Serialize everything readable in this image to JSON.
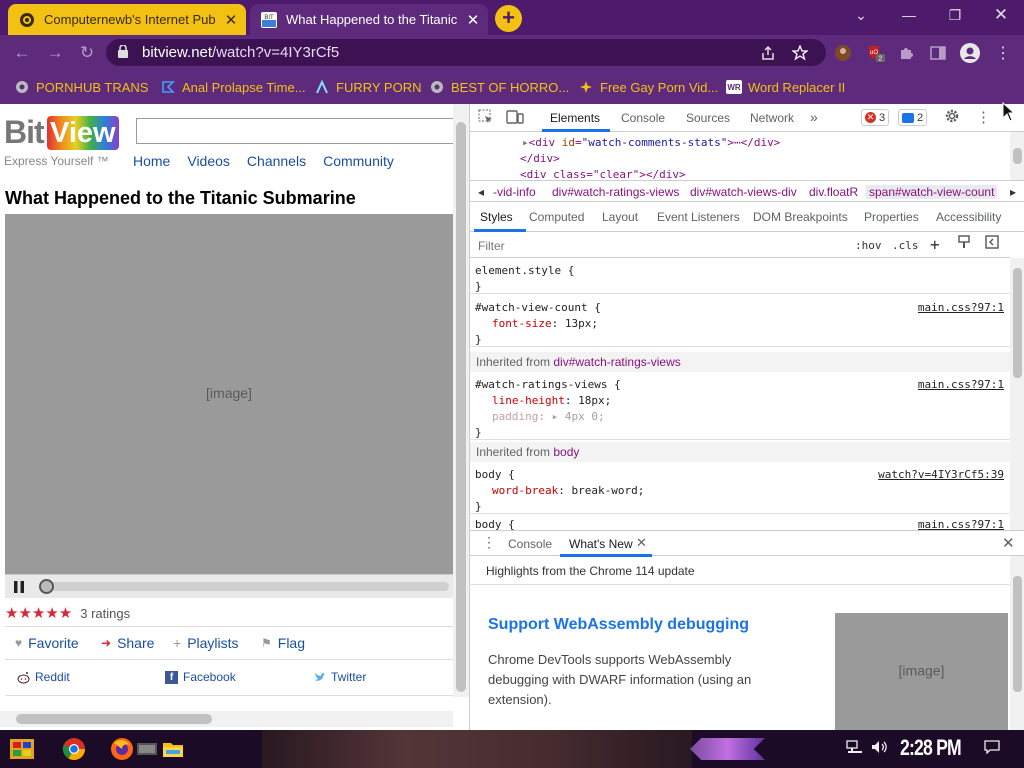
{
  "browser": {
    "tabs": [
      {
        "title": "Computernewb's Internet Pub",
        "close": "✕"
      },
      {
        "title": "What Happened to the Titanic",
        "close": "✕"
      }
    ],
    "new_tab_label": "+",
    "url_host": "bitview.net",
    "url_path": "/watch?v=4IY3rCf5",
    "bookmarks": [
      {
        "label": "PORNHUB TRANS"
      },
      {
        "label": "Anal Prolapse Time..."
      },
      {
        "label": "FURRY PORN"
      },
      {
        "label": "BEST OF HORRO..."
      },
      {
        "label": "Free Gay Porn Vid..."
      },
      {
        "label": "Word Replacer II"
      }
    ],
    "extension_badge": "2",
    "colors": {
      "frame": "#5d2a7c",
      "active_tab": "#f3c014",
      "bookmark_text": "#f3c014"
    }
  },
  "page": {
    "logo_bit": "Bit",
    "logo_view": "View",
    "tagline": "Express Yourself ™",
    "nav": [
      "Home",
      "Videos",
      "Channels",
      "Community"
    ],
    "video_title": "What Happened to the Titanic Submarine",
    "rating_stars": "★★★★★",
    "rating_value": 5,
    "ratings_count": "3 ratings",
    "actions": [
      {
        "label": "Favorite",
        "icon": "♥"
      },
      {
        "label": "Share",
        "icon": "➜"
      },
      {
        "label": "Playlists",
        "icon": "+"
      },
      {
        "label": "Flag",
        "icon": "⚑"
      }
    ],
    "shares": [
      {
        "label": "Reddit"
      },
      {
        "label": "Facebook"
      },
      {
        "label": "Twitter"
      }
    ]
  },
  "devtools": {
    "tabs": [
      "Elements",
      "Console",
      "Sources",
      "Network",
      "»"
    ],
    "errors": "3",
    "messages": "2",
    "dom_lines": [
      {
        "tag_open": "<div ",
        "attr": "id",
        "val": "\"watch-comments-stats\"",
        "rest": ">⋯</div>"
      },
      {
        "text": "</div>"
      },
      {
        "text": "<div class=\"clear\"></div>"
      }
    ],
    "breadcrumbs": [
      "◂",
      "-vid-info",
      "div#watch-ratings-views",
      "div#watch-views-div",
      "div.floatR",
      "span#watch-view-count",
      "▸"
    ],
    "style_tabs": [
      "Styles",
      "Computed",
      "Layout",
      "Event Listeners",
      "DOM Breakpoints",
      "Properties",
      "Accessibility"
    ],
    "filter_placeholder": "Filter",
    "hov": ":hov",
    "cls": ".cls",
    "rules": {
      "element_style": "element.style {",
      "close": "}",
      "view_count_sel": "#watch-view-count {",
      "view_count_prop": "font-size",
      "view_count_val": "13px;",
      "view_count_src": "main.css?97:1",
      "inherited_1": "Inherited from ",
      "inherited_1_tag": "div#watch-ratings-views",
      "ratings_sel": "#watch-ratings-views {",
      "ratings_p1": "line-height",
      "ratings_v1": "18px;",
      "ratings_p2": "padding",
      "ratings_v2": "▸ 4px 0;",
      "ratings_src": "main.css?97:1",
      "inherited_2": "Inherited from ",
      "inherited_2_tag": "body",
      "body_sel": "body {",
      "body_prop": "word-break",
      "body_val": "break-word;",
      "body_src": "watch?v=4IY3rCf5:39",
      "body2_sel": "body {",
      "body2_src": "main.css?97:1"
    },
    "drawer_tabs": [
      "Console",
      "What's New"
    ],
    "whats_new_header": "Highlights from the Chrome 114 update",
    "whats_new_title": "Support WebAssembly debugging",
    "whats_new_text": "Chrome DevTools supports WebAssembly debugging with DWARF information (using an extension)."
  },
  "taskbar": {
    "clock": "2:28 PM"
  }
}
